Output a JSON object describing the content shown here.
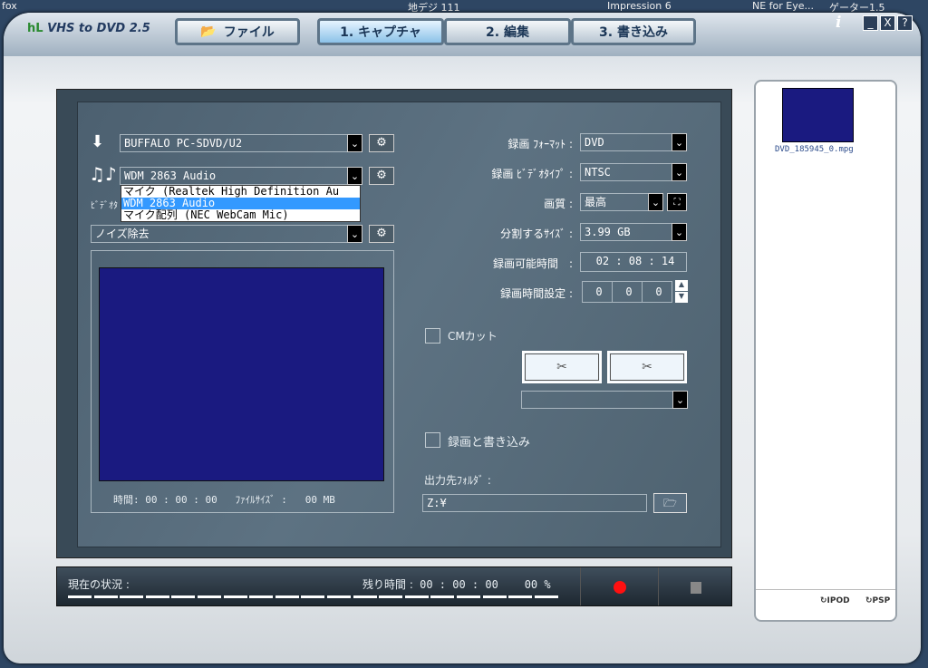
{
  "desktop": {
    "items": [
      "fox",
      "地デジ 111",
      "Impression 6",
      "NE for Eye...",
      "ゲーター1.5"
    ]
  },
  "app": {
    "title": "VHS to DVD 2.5",
    "logo_mark": "hL"
  },
  "tabs": [
    {
      "label": "ファイル"
    },
    {
      "label": "1. キャプチャ"
    },
    {
      "label": "2. 編集"
    },
    {
      "label": "3. 書き込み"
    }
  ],
  "window_buttons": {
    "info": "i",
    "minimize": "_",
    "close": "X",
    "help": "?"
  },
  "left": {
    "video_device": "BUFFALO PC-SDVD/U2",
    "audio_device": "WDM 2863 Audio",
    "audio_options": [
      "マイク (Realtek High Definition Au",
      "WDM 2863 Audio",
      "マイク配列 (NEC WebCam Mic)"
    ],
    "video_label_partial": "ﾋﾞﾃﾞｵﾀ",
    "filter": "ノイズ除去",
    "time_label": "時間:",
    "time_value": "00 : 00 : 00",
    "filesize_label": "ﾌｧｲﾙｻｲｽﾞ :",
    "filesize_value": "00 MB"
  },
  "right": {
    "format_label": "録画 ﾌｫｰﾏｯﾄ :",
    "format_value": "DVD",
    "videotype_label": "録画 ﾋﾞﾃﾞｵﾀｲﾌﾟ :",
    "videotype_value": "NTSC",
    "quality_label": "画質 :",
    "quality_value": "最高",
    "split_label": "分割するｻｲｽﾞ :",
    "split_value": "3.99 GB",
    "available_label": "録画可能時間　:",
    "available_value": "02 : 08 : 14",
    "rectime_label": "録画時間設定 :",
    "rectime_h": "0",
    "rectime_m": "0",
    "rectime_s": "0",
    "cmcut_label": "CMカット",
    "cmcut_checked": false,
    "record_burn_label": "録画と書き込み",
    "record_burn_checked": false,
    "output_label": "出力先ﾌｫﾙﾀﾞ :",
    "output_value": "Z:¥"
  },
  "status": {
    "label": "現在の状況 :",
    "remaining_label": "残り時間 :",
    "remaining_value": "00 : 00 : 00",
    "percent": "00 %",
    "progress": 0
  },
  "side": {
    "file_name": "DVD_185945_0.mpg",
    "ipod": "IPOD",
    "psp": "PSP"
  },
  "colors": {
    "preview": "#1a1a80",
    "record": "#ff1010",
    "selection": "#3399ff"
  }
}
